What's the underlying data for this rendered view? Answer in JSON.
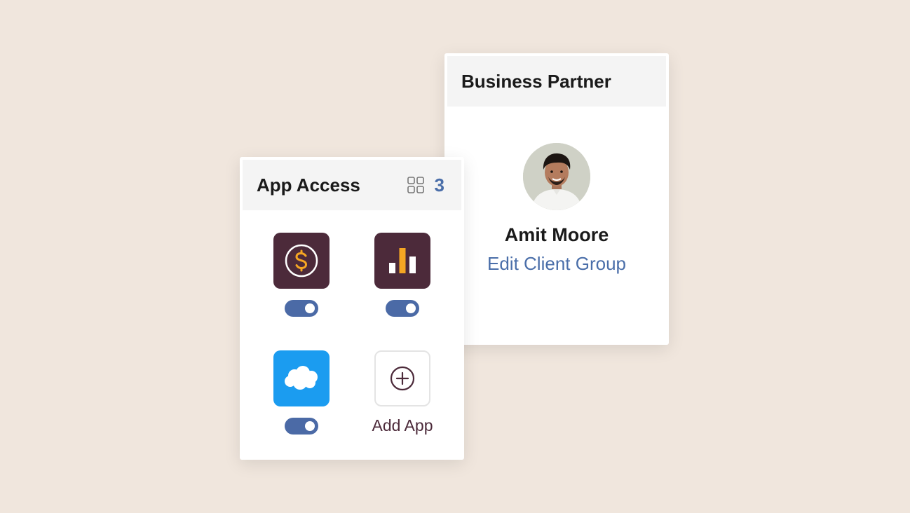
{
  "business_partner": {
    "title": "Business Partner",
    "name": "Amit Moore",
    "link": "Edit Client Group"
  },
  "app_access": {
    "title": "App Access",
    "count": "3",
    "apps": [
      {
        "icon": "dollar-circle-icon",
        "enabled": true
      },
      {
        "icon": "bar-chart-icon",
        "enabled": true
      },
      {
        "icon": "cloud-icon",
        "enabled": true
      }
    ],
    "add_label": "Add App"
  },
  "colors": {
    "background": "#f0e6dd",
    "accent": "#4a6ea9",
    "app_dark": "#4c2a3a",
    "app_blue": "#1b9cf0",
    "icon_orange": "#f5a623"
  }
}
